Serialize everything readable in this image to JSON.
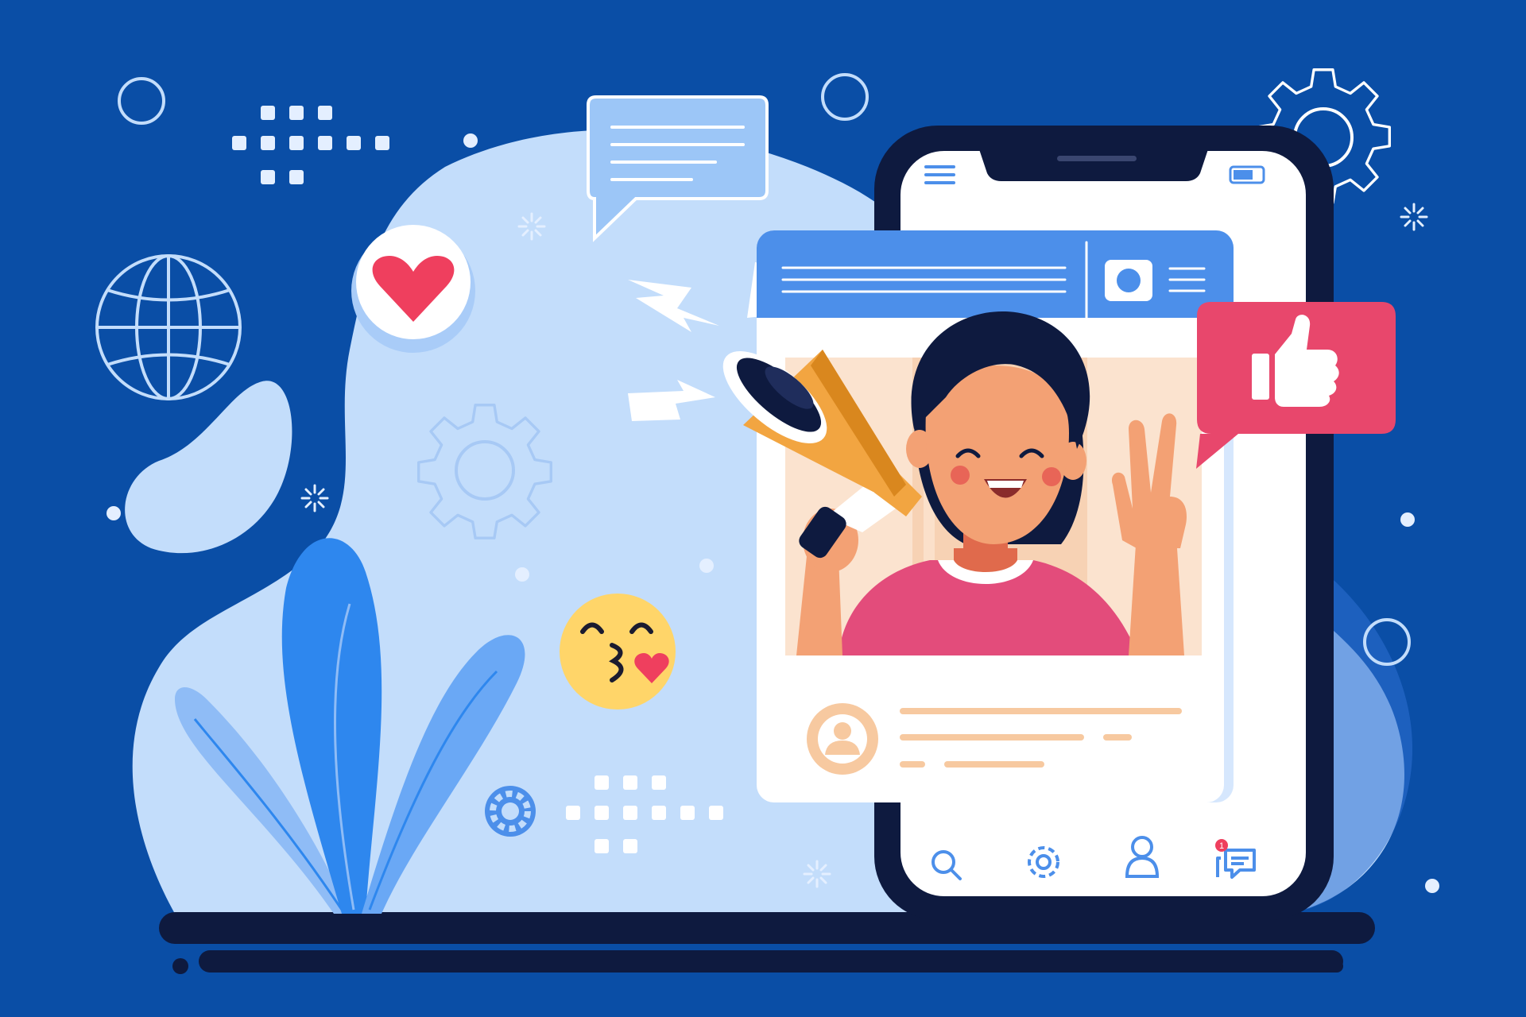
{
  "colors": {
    "background": "#0a4ea6",
    "blob": "#c3ddfb",
    "accent_blue": "#4c8fea",
    "phone_frame": "#0e1a3f",
    "like_pink": "#e8476c",
    "heart_red": "#ef3f5e",
    "emoji_yellow": "#ffd569",
    "shirt": "#e34c7b",
    "skin": "#f3a174",
    "megaphone": "#f2a541",
    "placeholder_lines": "#f7c9a0",
    "notification_badge": "#ef3f5e"
  },
  "icons": {
    "phone_header_left": "menu-icon",
    "phone_header_right": "battery-icon",
    "banner": "camera-icon",
    "like_bubble": "thumbs-up-icon",
    "heart_bubble": "heart-icon",
    "avatar": "user-icon",
    "nav": [
      "search-icon",
      "gear-icon",
      "person-icon",
      "chat-icon"
    ]
  },
  "notification": {
    "count": "1"
  }
}
